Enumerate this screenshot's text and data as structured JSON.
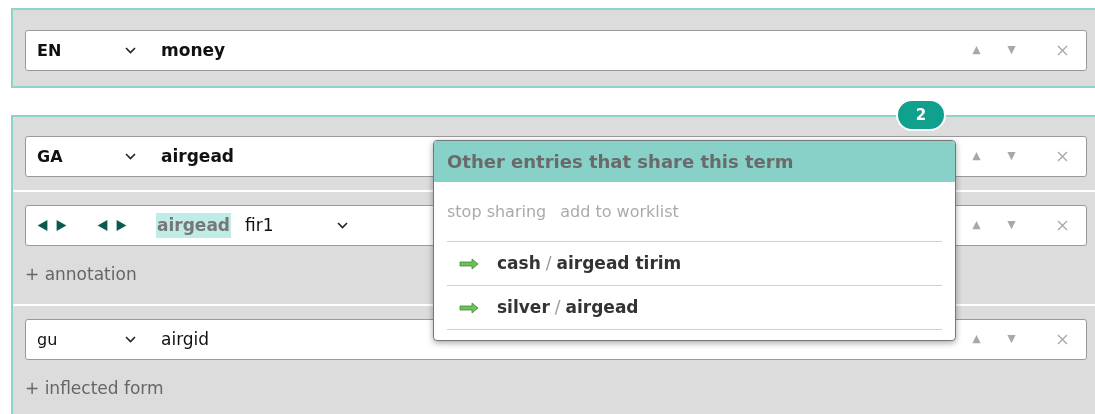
{
  "panels": [
    {
      "rows": [
        {
          "kind": "term",
          "language": "EN",
          "term": "money"
        }
      ]
    },
    {
      "badge": "2",
      "rows": [
        {
          "kind": "term",
          "language": "GA",
          "term": "airgead"
        },
        {
          "kind": "sense",
          "highlight": "airgead",
          "sense": "fir1",
          "link": "+ annotation"
        },
        {
          "kind": "form",
          "language": "gu",
          "term": "airgid",
          "link": "+ inflected form"
        }
      ]
    }
  ],
  "popup": {
    "title": "Other entries that share this term",
    "actions": [
      "stop sharing",
      "add to worklist"
    ],
    "entries": [
      {
        "headword": "cash",
        "separator": "/",
        "term": "airgead tirim"
      },
      {
        "headword": "silver",
        "separator": "/",
        "term": "airgead"
      }
    ]
  }
}
